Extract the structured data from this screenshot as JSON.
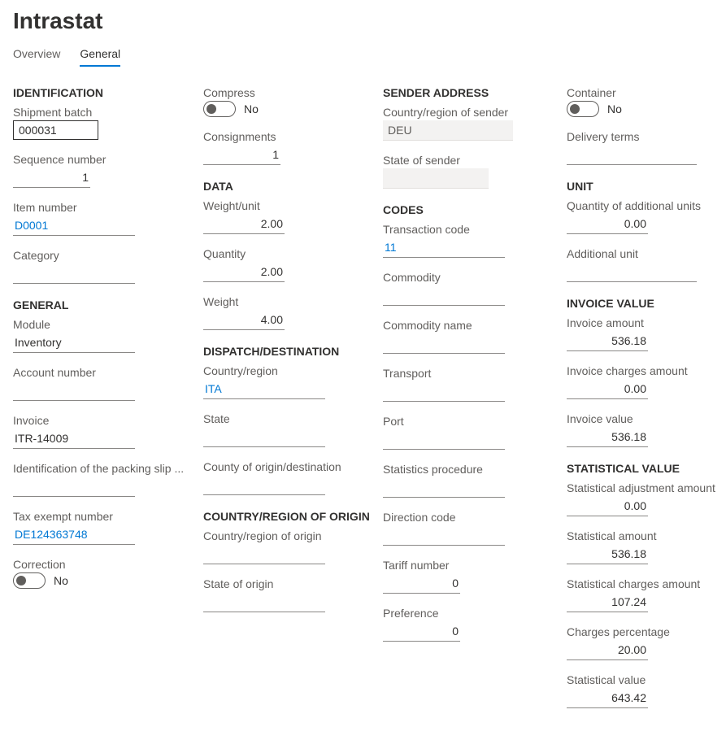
{
  "page": {
    "title": "Intrastat"
  },
  "tabs": {
    "overview": "Overview",
    "general": "General"
  },
  "sections": {
    "identification": "IDENTIFICATION",
    "general": "GENERAL",
    "data": "DATA",
    "dispatch": "DISPATCH/DESTINATION",
    "countryOrigin": "COUNTRY/REGION OF ORIGIN",
    "senderAddress": "SENDER ADDRESS",
    "codes": "CODES",
    "unit": "UNIT",
    "invoiceValue": "INVOICE VALUE",
    "statisticalValue": "STATISTICAL VALUE"
  },
  "identification": {
    "shipmentBatch_label": "Shipment batch",
    "shipmentBatch_value": "000031",
    "sequenceNumber_label": "Sequence number",
    "sequenceNumber_value": "1",
    "itemNumber_label": "Item number",
    "itemNumber_value": "D0001",
    "category_label": "Category",
    "category_value": ""
  },
  "general": {
    "module_label": "Module",
    "module_value": "Inventory",
    "accountNumber_label": "Account number",
    "accountNumber_value": "",
    "invoice_label": "Invoice",
    "invoice_value": "ITR-14009",
    "packingSlip_label": "Identification of the packing slip ...",
    "packingSlip_value": "",
    "taxExempt_label": "Tax exempt number",
    "taxExempt_value": "DE124363748",
    "correction_label": "Correction",
    "correction_value": "No"
  },
  "col2": {
    "compress_label": "Compress",
    "compress_value": "No",
    "consignments_label": "Consignments",
    "consignments_value": "1",
    "weightUnit_label": "Weight/unit",
    "weightUnit_value": "2.00",
    "quantity_label": "Quantity",
    "quantity_value": "2.00",
    "weight_label": "Weight",
    "weight_value": "4.00",
    "countryRegion_label": "Country/region",
    "countryRegion_value": "ITA",
    "state_label": "State",
    "state_value": "",
    "countyOrigin_label": "County of origin/destination",
    "countyOrigin_value": "",
    "countryRegionOrigin_label": "Country/region of origin",
    "countryRegionOrigin_value": "",
    "stateOrigin_label": "State of origin",
    "stateOrigin_value": ""
  },
  "col3": {
    "countrySender_label": "Country/region of sender",
    "countrySender_value": "DEU",
    "stateSender_label": "State of sender",
    "stateSender_value": "",
    "transactionCode_label": "Transaction code",
    "transactionCode_value": "11",
    "commodity_label": "Commodity",
    "commodity_value": "",
    "commodityName_label": "Commodity name",
    "commodityName_value": "",
    "transport_label": "Transport",
    "transport_value": "",
    "port_label": "Port",
    "port_value": "",
    "statisticsProcedure_label": "Statistics procedure",
    "statisticsProcedure_value": "",
    "directionCode_label": "Direction code",
    "directionCode_value": "",
    "tariffNumber_label": "Tariff number",
    "tariffNumber_value": "0",
    "preference_label": "Preference",
    "preference_value": "0"
  },
  "col4": {
    "container_label": "Container",
    "container_value": "No",
    "deliveryTerms_label": "Delivery terms",
    "deliveryTerms_value": "",
    "qtyAddUnits_label": "Quantity of additional units",
    "qtyAddUnits_value": "0.00",
    "addUnit_label": "Additional unit",
    "addUnit_value": "",
    "invoiceAmount_label": "Invoice amount",
    "invoiceAmount_value": "536.18",
    "invoiceCharges_label": "Invoice charges amount",
    "invoiceCharges_value": "0.00",
    "invoiceValue_label": "Invoice value",
    "invoiceValue_value": "536.18",
    "statAdj_label": "Statistical adjustment amount",
    "statAdj_value": "0.00",
    "statAmount_label": "Statistical amount",
    "statAmount_value": "536.18",
    "statCharges_label": "Statistical charges amount",
    "statCharges_value": "107.24",
    "chargesPct_label": "Charges percentage",
    "chargesPct_value": "20.00",
    "statValue_label": "Statistical value",
    "statValue_value": "643.42"
  }
}
